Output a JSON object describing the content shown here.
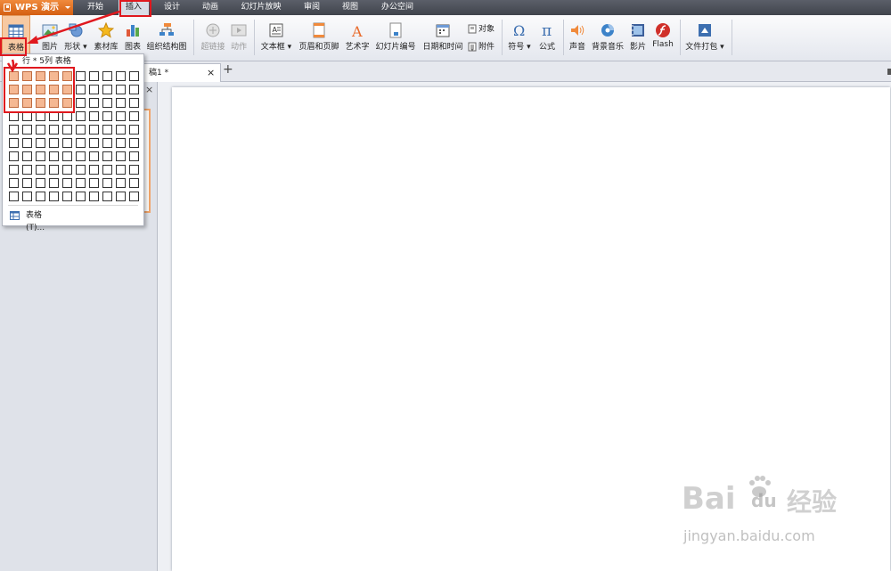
{
  "app": {
    "name": "WPS 演示",
    "brand_color": "#e8721f"
  },
  "menu": {
    "tabs": [
      "开始",
      "插入",
      "设计",
      "动画",
      "幻灯片放映",
      "审阅",
      "视图",
      "办公空间"
    ],
    "active": "插入"
  },
  "ribbon": {
    "table": "表格",
    "picture": "图片",
    "shape": "形状",
    "library": "素材库",
    "chart": "图表",
    "org_chart": "组织结构图",
    "hyperlink": "超链接",
    "action": "动作",
    "textbox": "文本框",
    "header_footer": "页眉和页脚",
    "wordart": "艺术字",
    "slide_number": "幻灯片编号",
    "datetime": "日期和时间",
    "object": "对象",
    "attachment": "附件",
    "symbol": "符号",
    "symbol_glyph": "Ω",
    "formula": "公式",
    "formula_glyph": "π",
    "sound": "声音",
    "bg_music": "背景音乐",
    "movie": "影片",
    "flash": "Flash",
    "package": "文件打包",
    "wordart_glyph": "A"
  },
  "doc_tabs": {
    "title": "稿1 *",
    "close": "×",
    "add": "+",
    "side_close": "×"
  },
  "table_dropdown": {
    "header": "行 * 5列 表格",
    "rows": 10,
    "cols": 10,
    "selected_rows": 3,
    "selected_cols": 5,
    "item_label": "表格(T)..."
  },
  "watermark": {
    "brand": "Bai",
    "brand2": "du",
    "brand_cn": "经验",
    "url": "jingyan.baidu.com"
  }
}
